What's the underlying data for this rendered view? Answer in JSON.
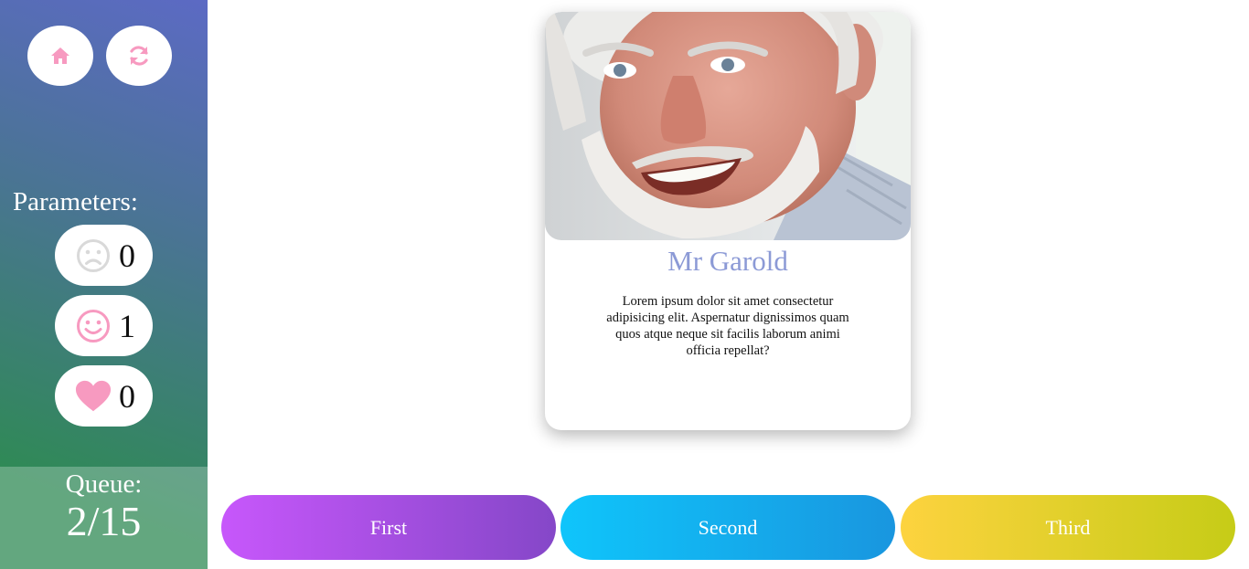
{
  "sidebar": {
    "home_icon": "home-icon",
    "refresh_icon": "refresh-icon",
    "parameters_title": "Parameters:",
    "parameters": [
      {
        "icon": "sad-face-icon",
        "value": "0",
        "color": "#d9d9d9"
      },
      {
        "icon": "smile-face-icon",
        "value": "1",
        "color": "#f79ac0"
      },
      {
        "icon": "heart-icon",
        "value": "0",
        "color": "#f79ac0"
      }
    ],
    "queue_label": "Queue:",
    "queue_value": "2/15"
  },
  "card": {
    "photo_icon": "portrait-photo",
    "name": "Mr Garold",
    "description": "Lorem ipsum dolor sit amet consectetur adipisicing elit. Aspernatur dignissimos quam quos atque neque sit facilis laborum animi officia repellat?"
  },
  "choices": {
    "first": "First",
    "second": "Second",
    "third": "Third"
  },
  "colors": {
    "accent_pink": "#f79ac0",
    "name_color": "#8c9ad6"
  }
}
